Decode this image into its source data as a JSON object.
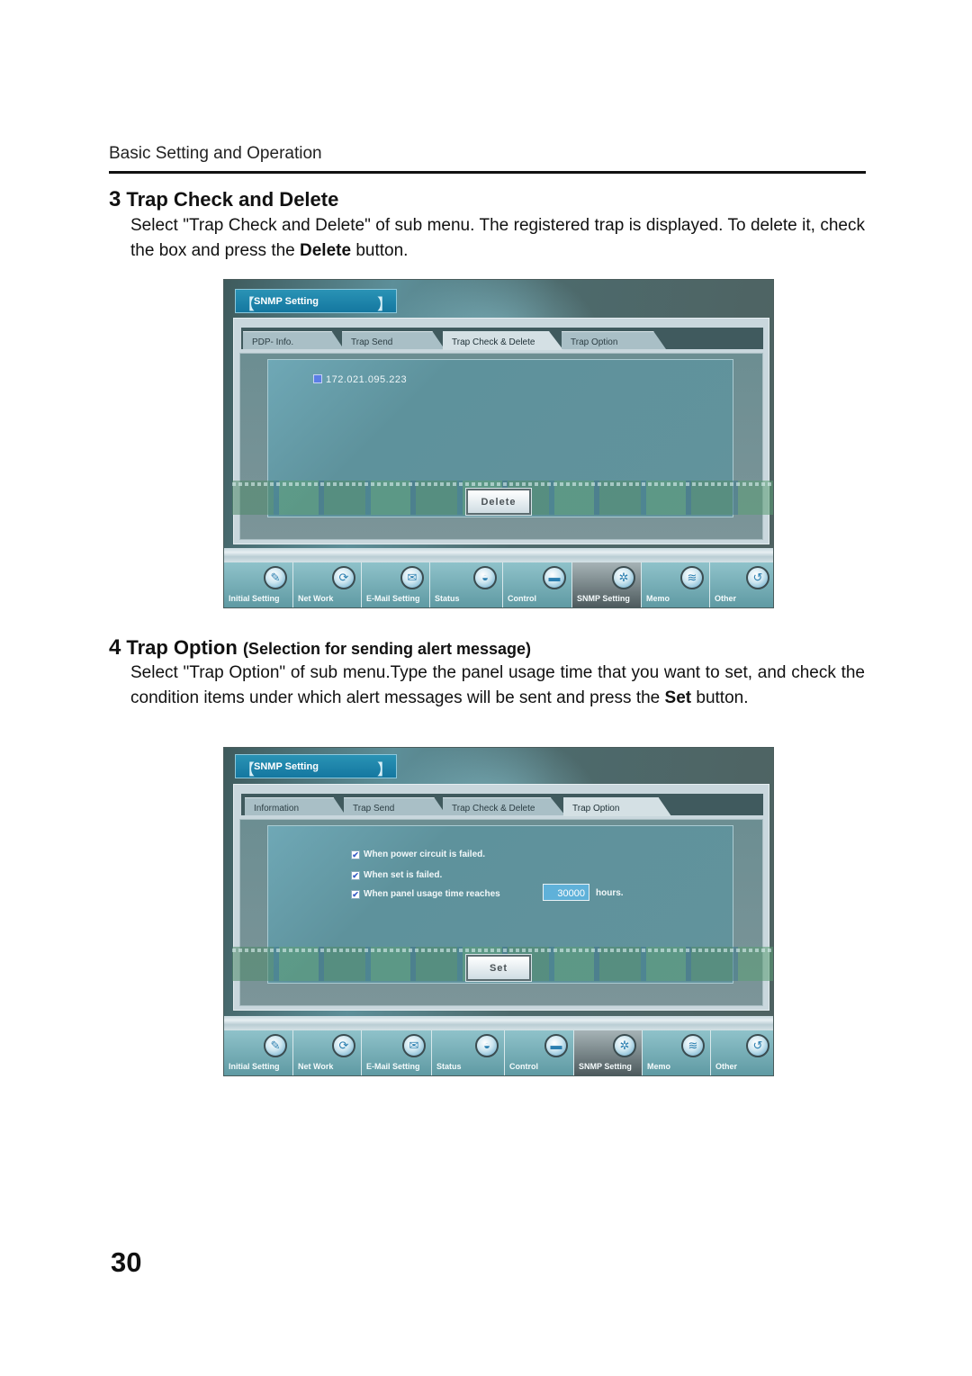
{
  "page": {
    "running_header": "Basic Setting and Operation",
    "page_number": "30"
  },
  "section3": {
    "number": "3",
    "title": "Trap Check and Delete",
    "body_part1": "Select \"Trap Check and Delete\" of sub menu. The registered trap is displayed. To delete it, check the box and press the ",
    "body_bold": "Delete",
    "body_part2": " button."
  },
  "section4": {
    "number": "4",
    "title": "Trap Option",
    "subtitle": "(Selection for sending alert message)",
    "body_part1": "Select \"Trap Option\" of sub menu.Type the panel usage time that you want to set, and check the condition items under which alert messages will be sent and press the ",
    "body_bold": "Set",
    "body_part2": " button."
  },
  "screen1": {
    "title": "SNMP Setting",
    "tabs": [
      {
        "label": "PDP- Info.",
        "active": false
      },
      {
        "label": "Trap Send",
        "active": false
      },
      {
        "label": "Trap Check & Delete",
        "active": true
      },
      {
        "label": "Trap Option",
        "active": false
      }
    ],
    "trap_entries": [
      {
        "ip": "172.021.095.223",
        "checked": false
      }
    ],
    "delete_button": "Delete"
  },
  "screen2": {
    "title": "SNMP Setting",
    "tabs": [
      {
        "label": "Information",
        "active": false
      },
      {
        "label": "Trap Send",
        "active": false
      },
      {
        "label": "Trap Check & Delete",
        "active": false
      },
      {
        "label": "Trap Option",
        "active": true
      }
    ],
    "conditions": [
      {
        "label": "When power circuit is failed.",
        "checked": true
      },
      {
        "label": "When set is failed.",
        "checked": true
      },
      {
        "label": "When panel usage time reaches",
        "checked": true
      }
    ],
    "usage_hours_value": "30000",
    "hours_unit": "hours.",
    "set_button": "Set"
  },
  "bracket_left": "【",
  "bracket_right": "】",
  "check_glyph": "✔",
  "nav": {
    "items": [
      {
        "label": "Initial Setting",
        "icon": "pen-icon",
        "glyph": "✎",
        "active": false
      },
      {
        "label": "Net Work",
        "icon": "network-icon",
        "glyph": "⟳",
        "active": false
      },
      {
        "label": "E-Mail Setting",
        "icon": "mail-icon",
        "glyph": "✉",
        "active": false
      },
      {
        "label": "Status",
        "icon": "status-icon",
        "glyph": "◒",
        "active": false
      },
      {
        "label": "Control",
        "icon": "control-icon",
        "glyph": "▬",
        "active": false
      },
      {
        "label": "SNMP Setting",
        "icon": "snmp-icon",
        "glyph": "✲",
        "active": true
      },
      {
        "label": "Memo",
        "icon": "memo-icon",
        "glyph": "≋",
        "active": false
      },
      {
        "label": "Other",
        "icon": "other-icon",
        "glyph": "↺",
        "active": false
      }
    ]
  }
}
